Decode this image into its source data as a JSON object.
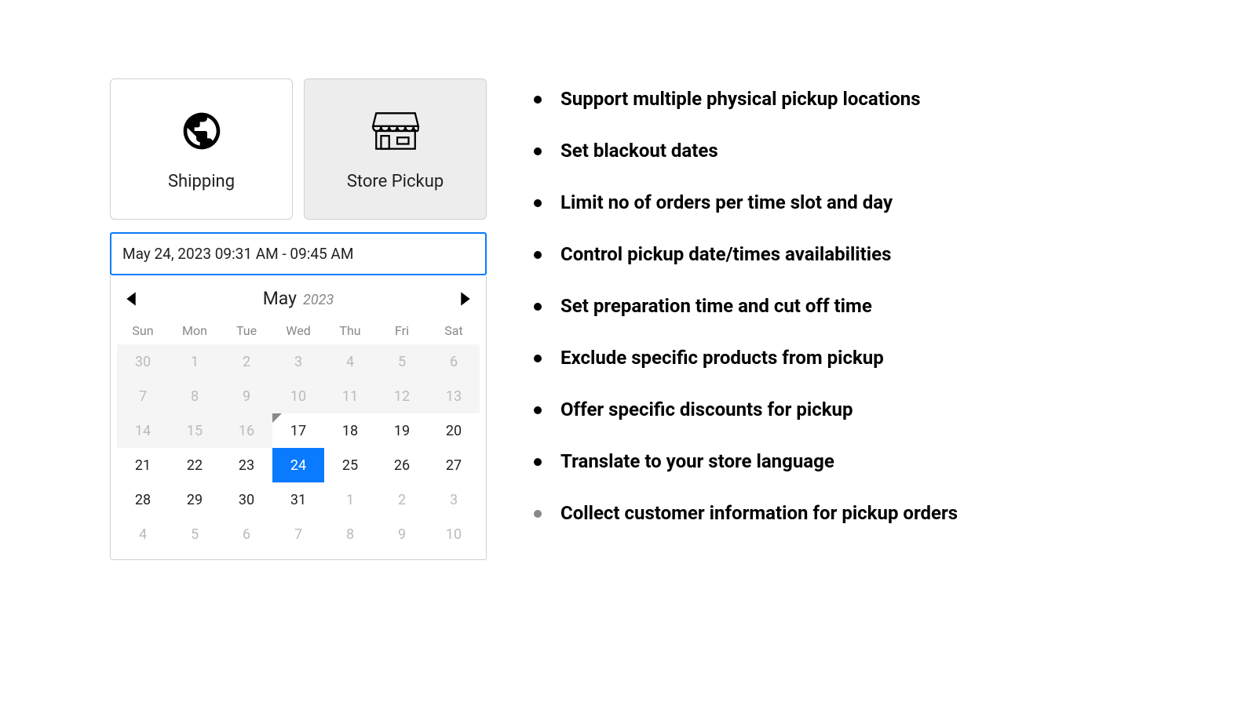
{
  "delivery": {
    "shipping_label": "Shipping",
    "pickup_label": "Store Pickup",
    "selected": "pickup"
  },
  "date_input": "May 24, 2023 09:31 AM - 09:45 AM",
  "calendar": {
    "month": "May",
    "year": "2023",
    "dow": [
      "Sun",
      "Mon",
      "Tue",
      "Wed",
      "Thu",
      "Fri",
      "Sat"
    ],
    "cells": [
      {
        "n": "30",
        "state": "disabled"
      },
      {
        "n": "1",
        "state": "disabled"
      },
      {
        "n": "2",
        "state": "disabled"
      },
      {
        "n": "3",
        "state": "disabled"
      },
      {
        "n": "4",
        "state": "disabled"
      },
      {
        "n": "5",
        "state": "disabled"
      },
      {
        "n": "6",
        "state": "disabled"
      },
      {
        "n": "7",
        "state": "disabled"
      },
      {
        "n": "8",
        "state": "disabled"
      },
      {
        "n": "9",
        "state": "disabled"
      },
      {
        "n": "10",
        "state": "disabled"
      },
      {
        "n": "11",
        "state": "disabled"
      },
      {
        "n": "12",
        "state": "disabled"
      },
      {
        "n": "13",
        "state": "disabled"
      },
      {
        "n": "14",
        "state": "disabled"
      },
      {
        "n": "15",
        "state": "disabled"
      },
      {
        "n": "16",
        "state": "disabled"
      },
      {
        "n": "17",
        "state": "current",
        "corner": true
      },
      {
        "n": "18",
        "state": "current"
      },
      {
        "n": "19",
        "state": "current"
      },
      {
        "n": "20",
        "state": "current"
      },
      {
        "n": "21",
        "state": "current"
      },
      {
        "n": "22",
        "state": "current"
      },
      {
        "n": "23",
        "state": "current"
      },
      {
        "n": "24",
        "state": "selected"
      },
      {
        "n": "25",
        "state": "current"
      },
      {
        "n": "26",
        "state": "current"
      },
      {
        "n": "27",
        "state": "current"
      },
      {
        "n": "28",
        "state": "current"
      },
      {
        "n": "29",
        "state": "current"
      },
      {
        "n": "30",
        "state": "current"
      },
      {
        "n": "31",
        "state": "current"
      },
      {
        "n": "1",
        "state": "out-month"
      },
      {
        "n": "2",
        "state": "out-month"
      },
      {
        "n": "3",
        "state": "out-month"
      },
      {
        "n": "4",
        "state": "out-month"
      },
      {
        "n": "5",
        "state": "out-month"
      },
      {
        "n": "6",
        "state": "out-month"
      },
      {
        "n": "7",
        "state": "out-month"
      },
      {
        "n": "8",
        "state": "out-month"
      },
      {
        "n": "9",
        "state": "out-month"
      },
      {
        "n": "10",
        "state": "out-month"
      }
    ]
  },
  "features": [
    {
      "text": "Support multiple physical pickup locations",
      "grey": false
    },
    {
      "text": "Set blackout dates",
      "grey": false
    },
    {
      "text": "Limit no of orders per time slot and day",
      "grey": false
    },
    {
      "text": "Control pickup date/times availabilities",
      "grey": false
    },
    {
      "text": "Set preparation time and cut off time",
      "grey": false
    },
    {
      "text": "Exclude specific products from pickup",
      "grey": false
    },
    {
      "text": "Offer specific discounts for pickup",
      "grey": false
    },
    {
      "text": "Translate to your store language",
      "grey": false
    },
    {
      "text": "Collect customer information for pickup orders",
      "grey": true
    }
  ]
}
